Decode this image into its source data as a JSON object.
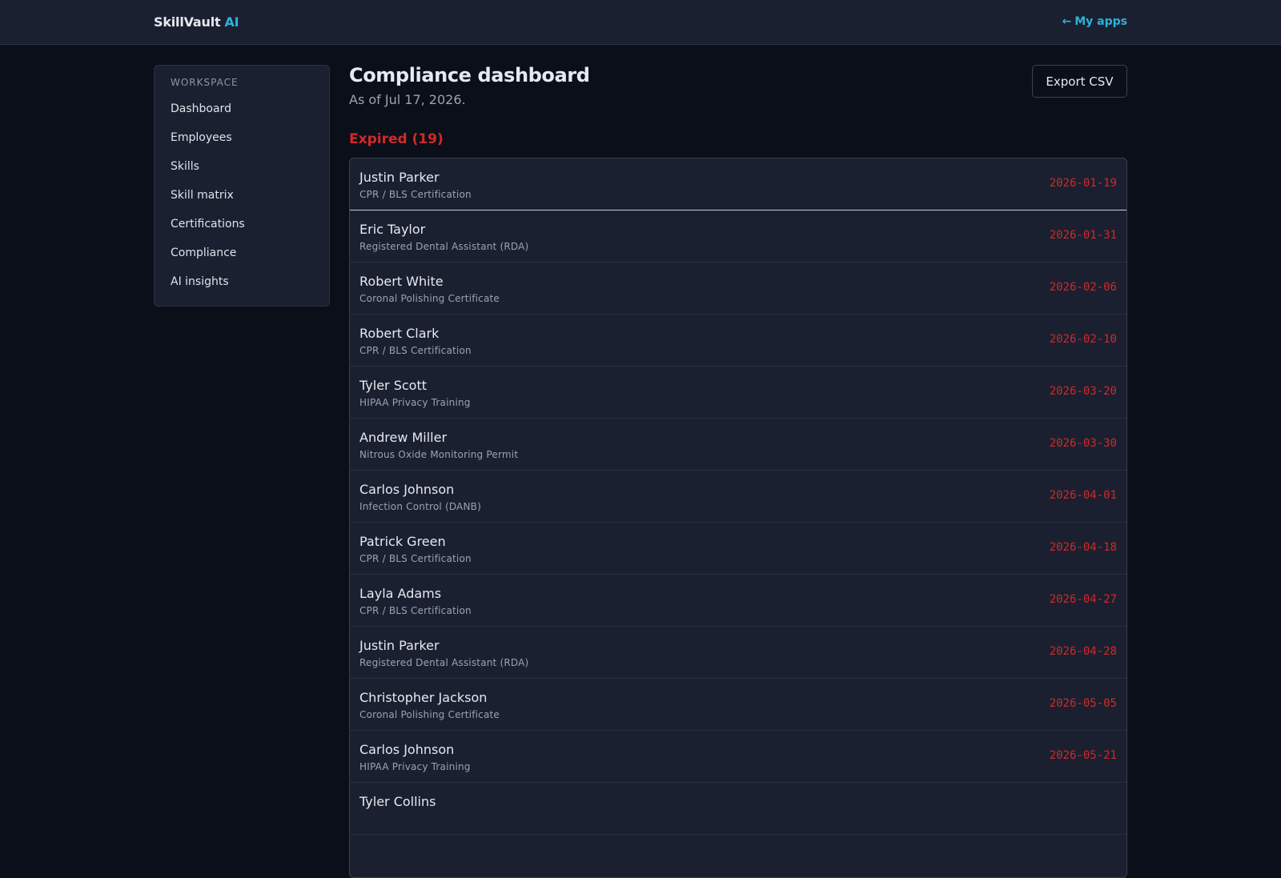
{
  "header": {
    "brand_name": "SkillVault",
    "brand_accent": "AI",
    "my_apps_label": "My apps",
    "back_arrow_icon": "arrow-left-icon"
  },
  "sidebar": {
    "section_label": "WORKSPACE",
    "items": [
      {
        "label": "Dashboard"
      },
      {
        "label": "Employees"
      },
      {
        "label": "Skills"
      },
      {
        "label": "Skill matrix"
      },
      {
        "label": "Certifications"
      },
      {
        "label": "Compliance"
      },
      {
        "label": "AI insights"
      }
    ]
  },
  "main": {
    "title": "Compliance dashboard",
    "subtitle": "As of Jul 17, 2026.",
    "export_label": "Export CSV",
    "expired": {
      "title": "Expired (19)",
      "rows": [
        {
          "name": "Justin Parker",
          "cert": "CPR / BLS Certification",
          "date": "2026-01-19"
        },
        {
          "name": "Eric Taylor",
          "cert": "Registered Dental Assistant (RDA)",
          "date": "2026-01-31"
        },
        {
          "name": "Robert White",
          "cert": "Coronal Polishing Certificate",
          "date": "2026-02-06"
        },
        {
          "name": "Robert Clark",
          "cert": "CPR / BLS Certification",
          "date": "2026-02-10"
        },
        {
          "name": "Tyler Scott",
          "cert": "HIPAA Privacy Training",
          "date": "2026-03-20"
        },
        {
          "name": "Andrew Miller",
          "cert": "Nitrous Oxide Monitoring Permit",
          "date": "2026-03-30"
        },
        {
          "name": "Carlos Johnson",
          "cert": "Infection Control (DANB)",
          "date": "2026-04-01"
        },
        {
          "name": "Patrick Green",
          "cert": "CPR / BLS Certification",
          "date": "2026-04-18"
        },
        {
          "name": "Layla Adams",
          "cert": "CPR / BLS Certification",
          "date": "2026-04-27"
        },
        {
          "name": "Justin Parker",
          "cert": "Registered Dental Assistant (RDA)",
          "date": "2026-04-28"
        },
        {
          "name": "Christopher Jackson",
          "cert": "Coronal Polishing Certificate",
          "date": "2026-05-05"
        },
        {
          "name": "Carlos Johnson",
          "cert": "HIPAA Privacy Training",
          "date": "2026-05-21"
        },
        {
          "name": "Tyler Collins",
          "cert": "",
          "date": ""
        }
      ]
    }
  },
  "colors": {
    "accent": "#2bb3d9",
    "expired": "#d02a2a",
    "background": "#0b0f1a",
    "panel": "#1a2030"
  }
}
